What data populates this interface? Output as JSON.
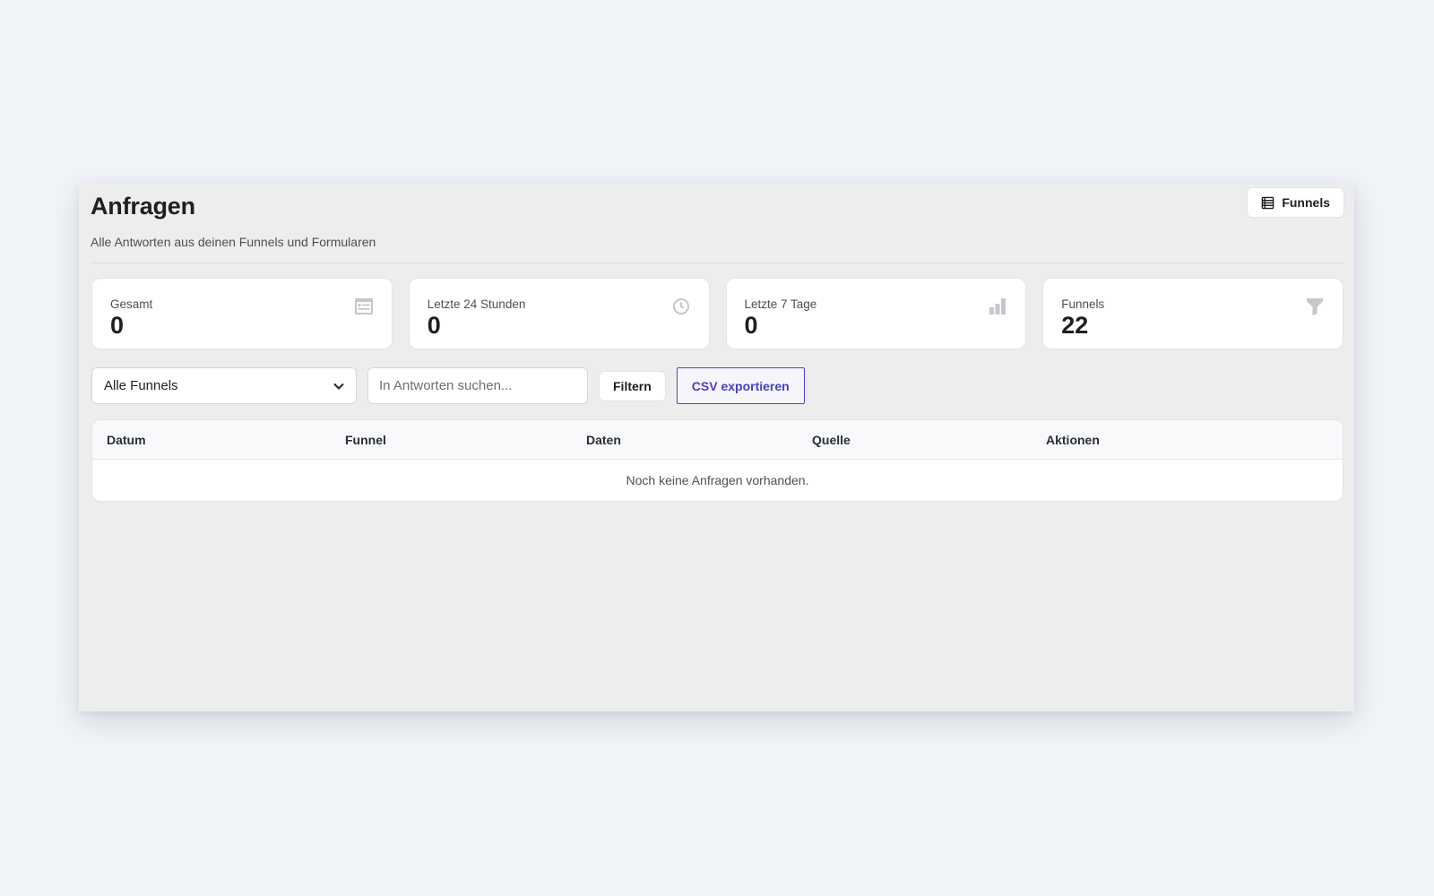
{
  "header": {
    "title": "Anfragen",
    "subtitle": "Alle Antworten aus deinen Funnels und Formularen",
    "funnels_button": "Funnels"
  },
  "stats": [
    {
      "label": "Gesamt",
      "value": "0",
      "icon": "inbox-icon"
    },
    {
      "label": "Letzte 24 Stunden",
      "value": "0",
      "icon": "clock-icon"
    },
    {
      "label": "Letzte 7 Tage",
      "value": "0",
      "icon": "bar-chart-icon"
    },
    {
      "label": "Funnels",
      "value": "22",
      "icon": "filter-icon"
    }
  ],
  "toolbar": {
    "funnel_select_value": "Alle Funnels",
    "search_placeholder": "In Antworten suchen...",
    "filter_button": "Filtern",
    "export_button": "CSV exportieren"
  },
  "table": {
    "columns": [
      "Datum",
      "Funnel",
      "Daten",
      "Quelle",
      "Aktionen"
    ],
    "empty_message": "Noch keine Anfragen vorhanden."
  },
  "colors": {
    "accent": "#4f46c8",
    "page_background": "#f1f4f8",
    "panel_background": "#ededed",
    "icon_muted": "#b9bcc2"
  }
}
